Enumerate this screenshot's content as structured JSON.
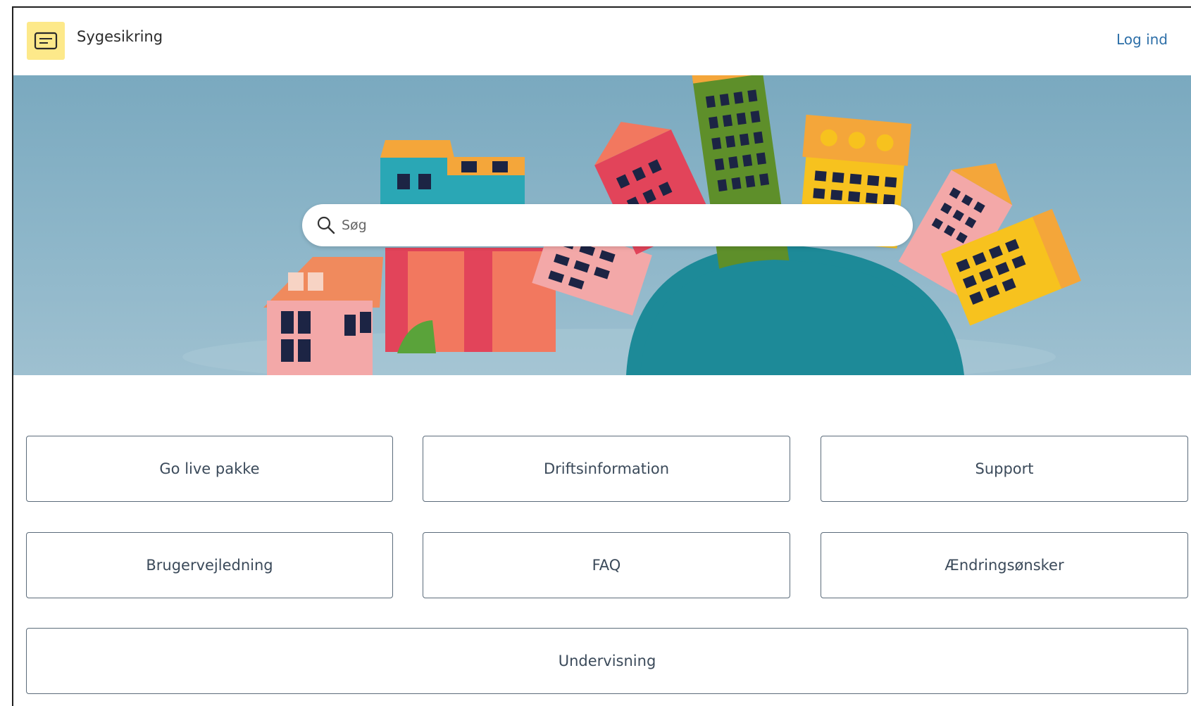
{
  "header": {
    "site_title": "Sygesikring",
    "login_label": "Log ind",
    "logo_icon": "message-icon",
    "logo_bg_color": "#fde98a"
  },
  "hero": {
    "search": {
      "placeholder": "Søg",
      "value": ""
    }
  },
  "tiles": [
    {
      "label": "Go live pakke"
    },
    {
      "label": "Driftsinformation"
    },
    {
      "label": "Support"
    },
    {
      "label": "Brugervejledning"
    },
    {
      "label": "FAQ"
    },
    {
      "label": "Ændringsønsker"
    },
    {
      "label": "Undervisning"
    }
  ],
  "colors": {
    "link": "#2d6fa8",
    "tile_border": "#5b6b7a",
    "hero_sky": "#7aa9bf"
  }
}
